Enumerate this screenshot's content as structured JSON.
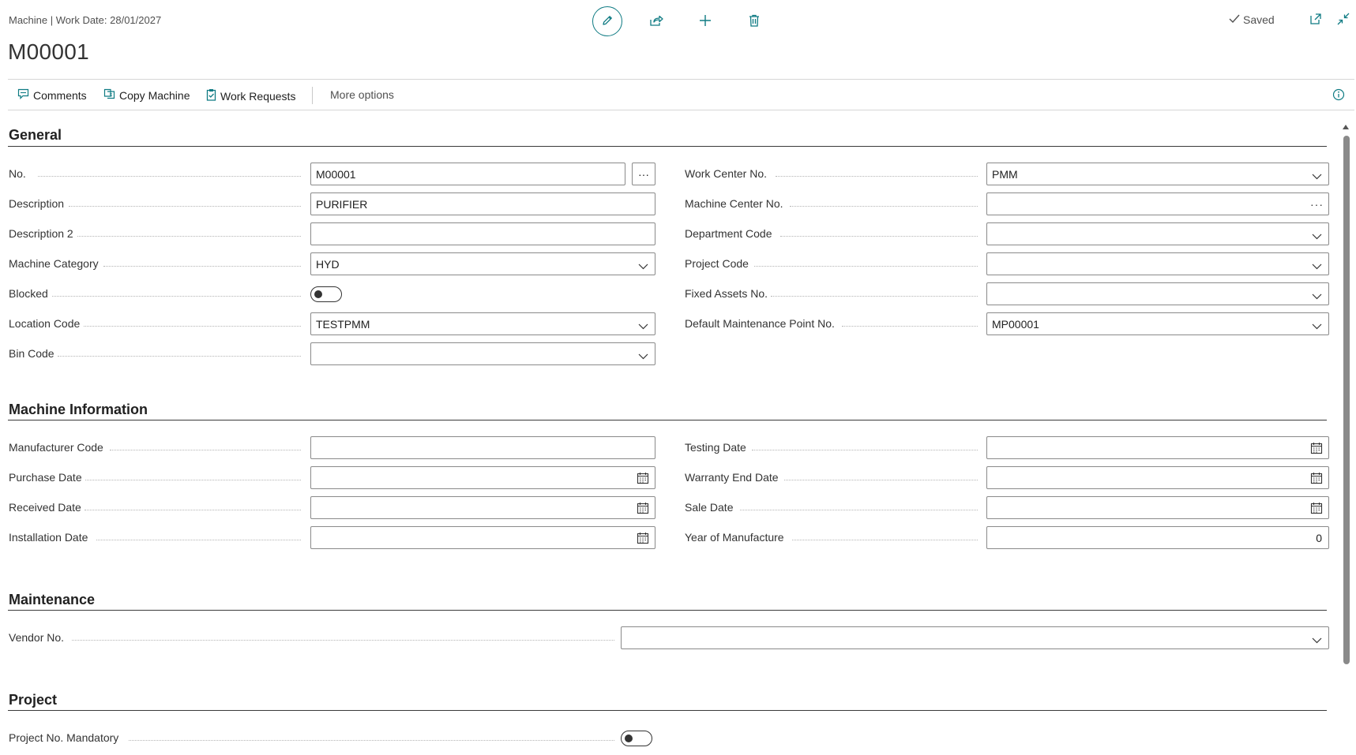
{
  "header": {
    "breadcrumb": "Machine | Work Date: 28/01/2027",
    "title": "M00001",
    "saved_label": "Saved",
    "icons": [
      "edit-icon",
      "share-icon",
      "add-icon",
      "delete-icon",
      "open-new-window-icon",
      "collapse-icon",
      "checkmark-icon"
    ]
  },
  "actions": {
    "comments": "Comments",
    "copy_machine": "Copy Machine",
    "work_requests": "Work Requests",
    "more_options": "More options"
  },
  "general": {
    "title": "General",
    "left": [
      {
        "label": "No.",
        "value": "M00001",
        "control": "text-assist"
      },
      {
        "label": "Description",
        "value": "PURIFIER",
        "control": "text"
      },
      {
        "label": "Description 2",
        "value": "",
        "control": "text"
      },
      {
        "label": "Machine Category",
        "value": "HYD",
        "control": "dropdown"
      },
      {
        "label": "Blocked",
        "value": "off",
        "control": "toggle"
      },
      {
        "label": "Location Code",
        "value": "TESTPMM",
        "control": "dropdown"
      },
      {
        "label": "Bin Code",
        "value": "",
        "control": "dropdown"
      }
    ],
    "right": [
      {
        "label": "Work Center No.",
        "value": "PMM",
        "control": "dropdown"
      },
      {
        "label": "Machine Center No.",
        "value": "",
        "control": "ellipsis"
      },
      {
        "label": "Department Code",
        "value": "",
        "control": "dropdown"
      },
      {
        "label": "Project Code",
        "value": "",
        "control": "dropdown"
      },
      {
        "label": "Fixed Assets No.",
        "value": "",
        "control": "dropdown"
      },
      {
        "label": "Default Maintenance Point No.",
        "value": "MP00001",
        "control": "dropdown"
      }
    ]
  },
  "machine_info": {
    "title": "Machine Information",
    "left": [
      {
        "label": "Manufacturer Code",
        "value": "",
        "control": "text"
      },
      {
        "label": "Purchase Date",
        "value": "",
        "control": "date"
      },
      {
        "label": "Received Date",
        "value": "",
        "control": "date"
      },
      {
        "label": "Installation Date",
        "value": "",
        "control": "date"
      }
    ],
    "right": [
      {
        "label": "Testing Date",
        "value": "",
        "control": "date"
      },
      {
        "label": "Warranty End Date",
        "value": "",
        "control": "date"
      },
      {
        "label": "Sale Date",
        "value": "",
        "control": "date"
      },
      {
        "label": "Year of Manufacture",
        "value": "0",
        "control": "number"
      }
    ]
  },
  "maintenance": {
    "title": "Maintenance",
    "vendor_label": "Vendor No.",
    "vendor_value": ""
  },
  "project": {
    "title": "Project",
    "mandatory_label": "Project No. Mandatory",
    "mandatory_value": "off"
  },
  "colors": {
    "accent": "#0f7b83",
    "text": "#212121",
    "border": "#8a8a8a"
  }
}
